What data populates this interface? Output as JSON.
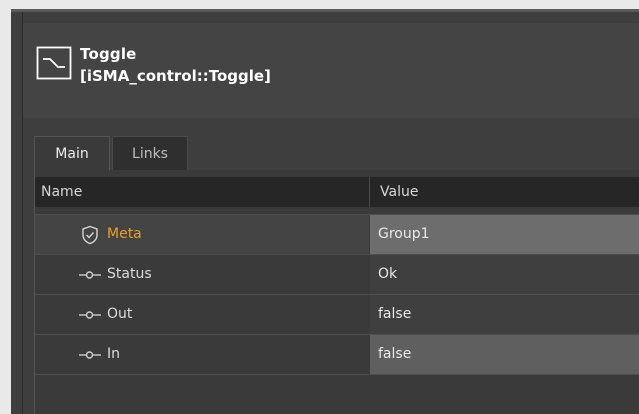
{
  "object": {
    "title": "Toggle",
    "subtitle": "[iSMA_control::Toggle]",
    "icon": "toggle-component-icon"
  },
  "tabs": [
    {
      "label": "Main",
      "active": true
    },
    {
      "label": "Links",
      "active": false
    }
  ],
  "table": {
    "columns": [
      "Name",
      "Value"
    ],
    "rows": [
      {
        "icon": "shield-icon",
        "name": "Meta",
        "value": "Group1"
      },
      {
        "icon": "pin-icon",
        "name": "Status",
        "value": "Ok"
      },
      {
        "icon": "pin-icon",
        "name": "Out",
        "value": "false"
      },
      {
        "icon": "pin-icon",
        "name": "In",
        "value": "false"
      }
    ]
  },
  "colors": {
    "background": "#3e3e3e",
    "header": "#444444",
    "meta_label": "#e8a023",
    "selected_value": "#6d6d6d"
  }
}
